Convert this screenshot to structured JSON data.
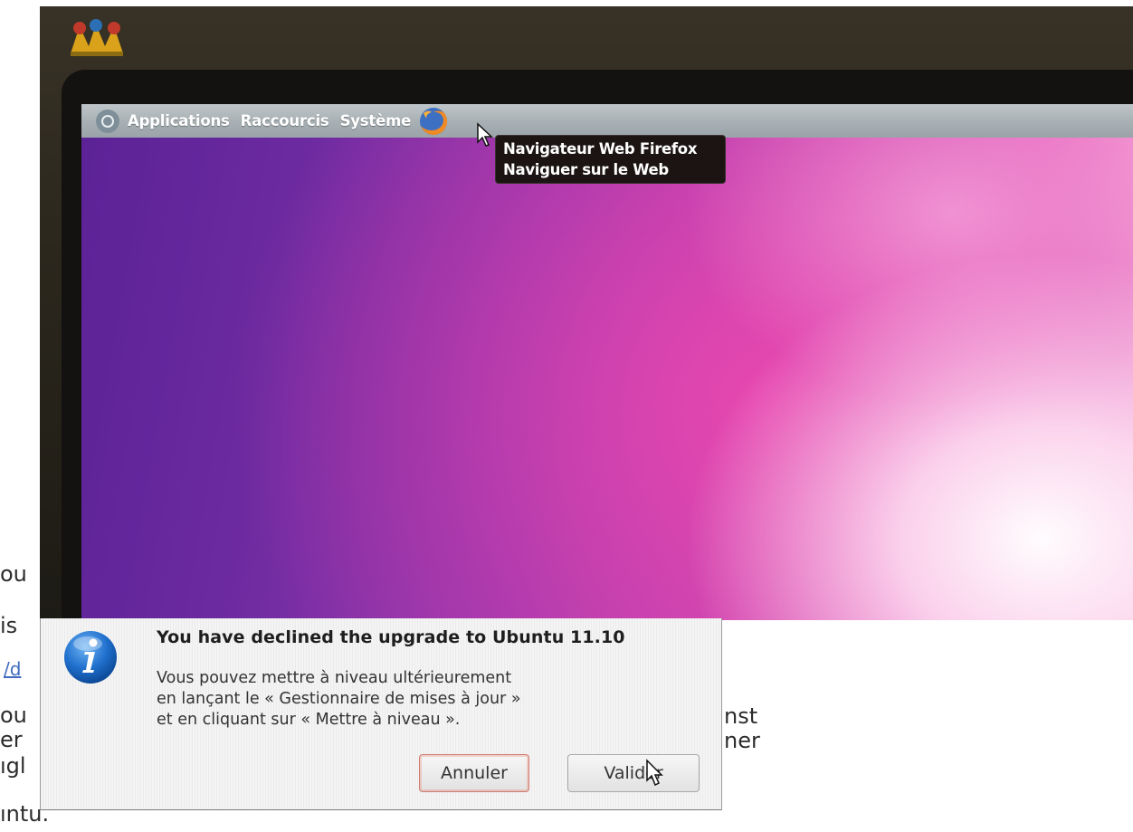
{
  "top_panel": {
    "menus": [
      "Applications",
      "Raccourcis",
      "Système"
    ]
  },
  "tooltip": {
    "line1": "Navigateur Web Firefox",
    "line2": "Naviguer sur le Web"
  },
  "background_doc": {
    "fragments": [
      "ou",
      "is",
      "/d",
      "ou",
      "er",
      "ıgl",
      "ıntu.",
      "nst",
      "ner"
    ]
  },
  "dialog": {
    "title": "You have declined the upgrade to Ubuntu 11.10",
    "message": "Vous pouvez mettre à niveau ultérieurement\nen lançant le « Gestionnaire de mises à jour »\net en cliquant sur « Mettre à niveau ».",
    "cancel_label": "Annuler",
    "ok_label": "Valider"
  },
  "colors": {
    "panel": "#a9b1b5",
    "tooltip_bg": "#1b1412",
    "wallpaper_purple": "#6c2aa0",
    "wallpaper_pink": "#e84aae",
    "info_icon_blue": "#1f6fcc"
  }
}
